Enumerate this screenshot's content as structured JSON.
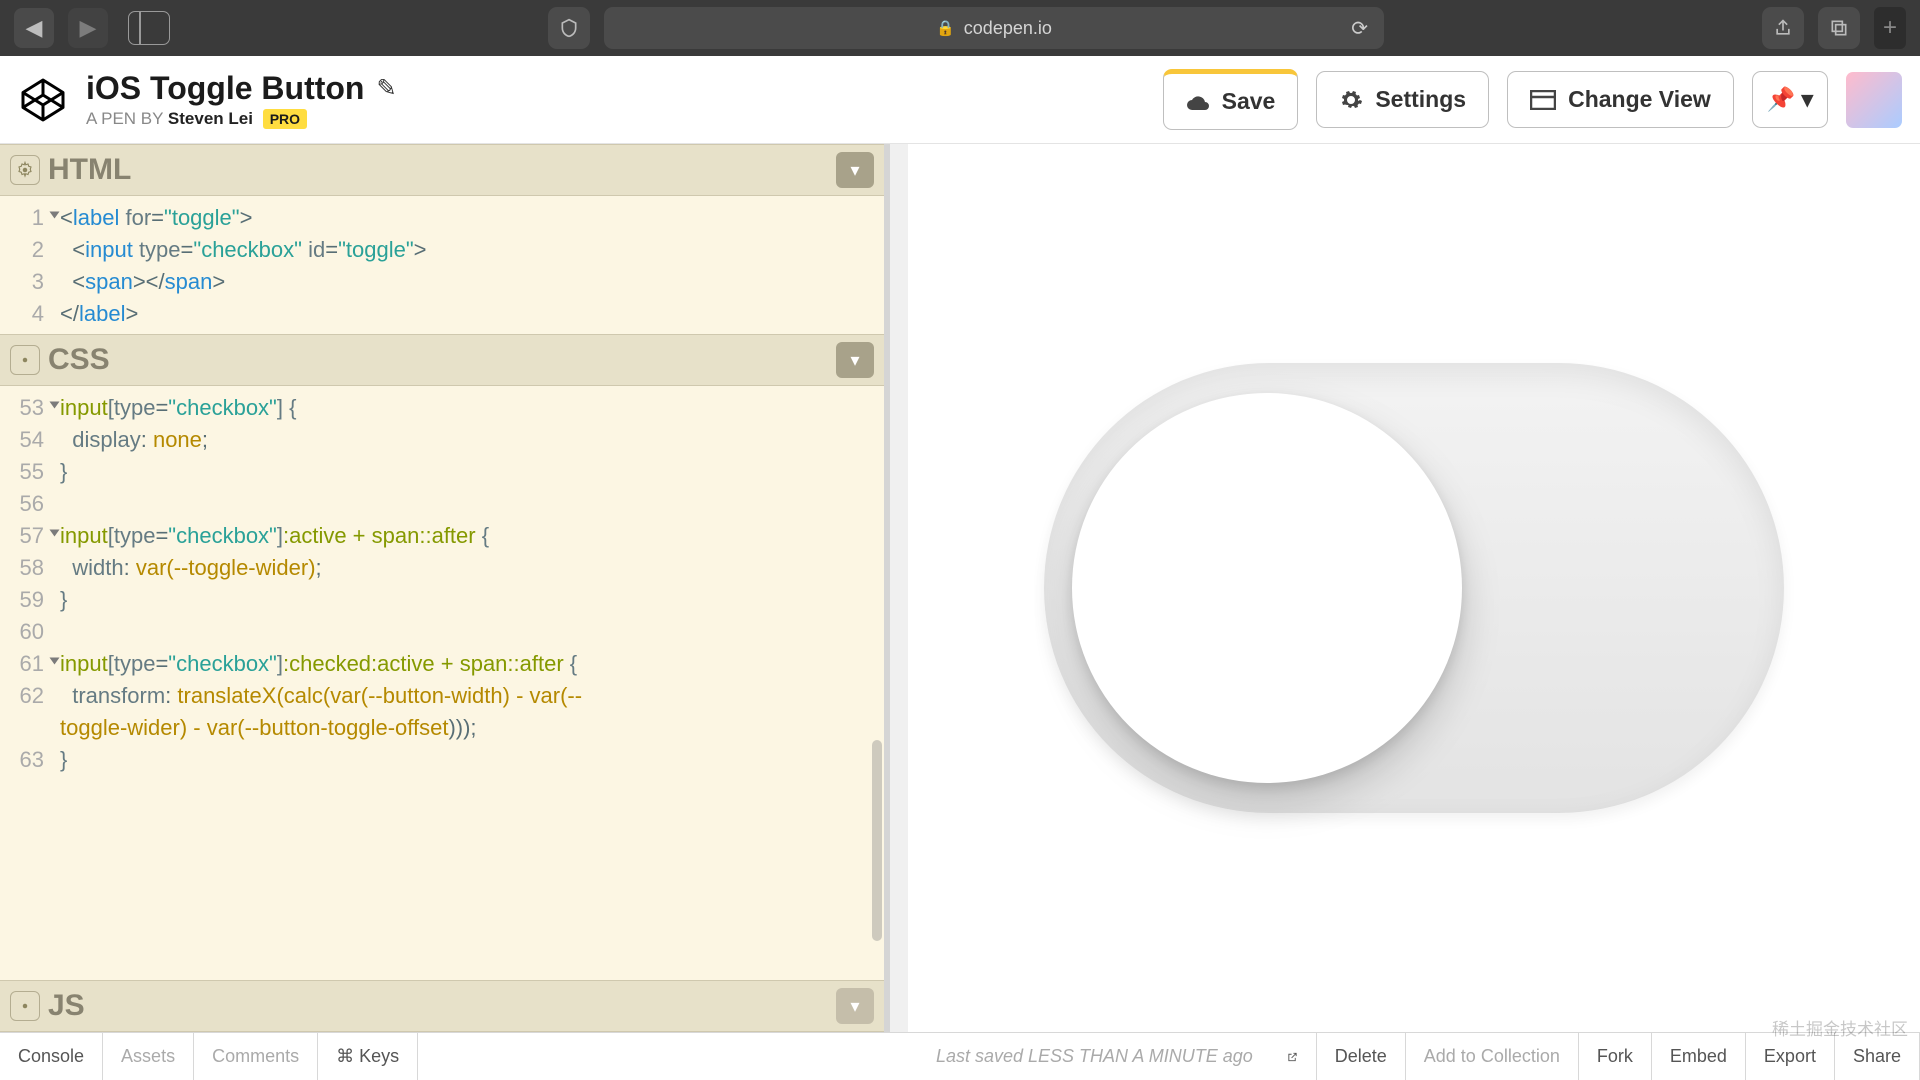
{
  "browser": {
    "domain": "codepen.io"
  },
  "header": {
    "pen_title": "iOS Toggle Button",
    "pen_by_prefix": "A PEN BY ",
    "author": "Steven Lei",
    "pro_badge": "PRO",
    "save": "Save",
    "settings": "Settings",
    "change_view": "Change View"
  },
  "panels": {
    "html_title": "HTML",
    "css_title": "CSS",
    "js_title": "JS"
  },
  "html_code": {
    "lines": [
      "1",
      "2",
      "3",
      "4"
    ],
    "l1_tag": "label",
    "l1_attr": "for",
    "l1_val": "\"toggle\"",
    "l2_tag": "input",
    "l2_attr1": "type",
    "l2_val1": "\"checkbox\"",
    "l2_attr2": "id",
    "l2_val2": "\"toggle\"",
    "l3_tag": "span",
    "l4_tag": "label"
  },
  "css_code": {
    "l53": "53",
    "l54": "54",
    "l55": "55",
    "l56": "56",
    "l57": "57",
    "l58": "58",
    "l59": "59",
    "l60": "60",
    "l61": "61",
    "l62": "62",
    "l63": "63",
    "sel1_a": "input",
    "sel1_b": "[",
    "sel1_c": "type",
    "sel1_d": "=",
    "sel1_e": "\"checkbox\"",
    "sel1_f": "]",
    "brace_o": " {",
    "brace_c": "}",
    "p_display": "display",
    "p_none": "none",
    "sel2_suffix": ":active + ",
    "sel2_span": "span",
    "sel2_after": "::after",
    "p_width": "width",
    "p_var_tw": "var(--toggle-wider)",
    "sel3_mid": ":checked:active + ",
    "p_transform": "transform",
    "v_tx_a": "translateX(calc(var(",
    "v_tx_b": "--button-width",
    "v_tx_c": ") - var(",
    "v_tx_d": "--",
    "v_tx_line2_a": "toggle-wider",
    "v_tx_line2_b": ") - var(",
    "v_tx_line2_c": "--button-toggle-offset",
    "v_tx_line2_d": ")));"
  },
  "footer": {
    "console": "Console",
    "assets": "Assets",
    "comments": "Comments",
    "keys": "⌘ Keys",
    "status": "Last saved LESS THAN A MINUTE ago",
    "delete": "Delete",
    "add": "Add to Collection",
    "fork": "Fork",
    "embed": "Embed",
    "export": "Export",
    "share": "Share"
  },
  "watermark": "稀土掘金技术社区"
}
